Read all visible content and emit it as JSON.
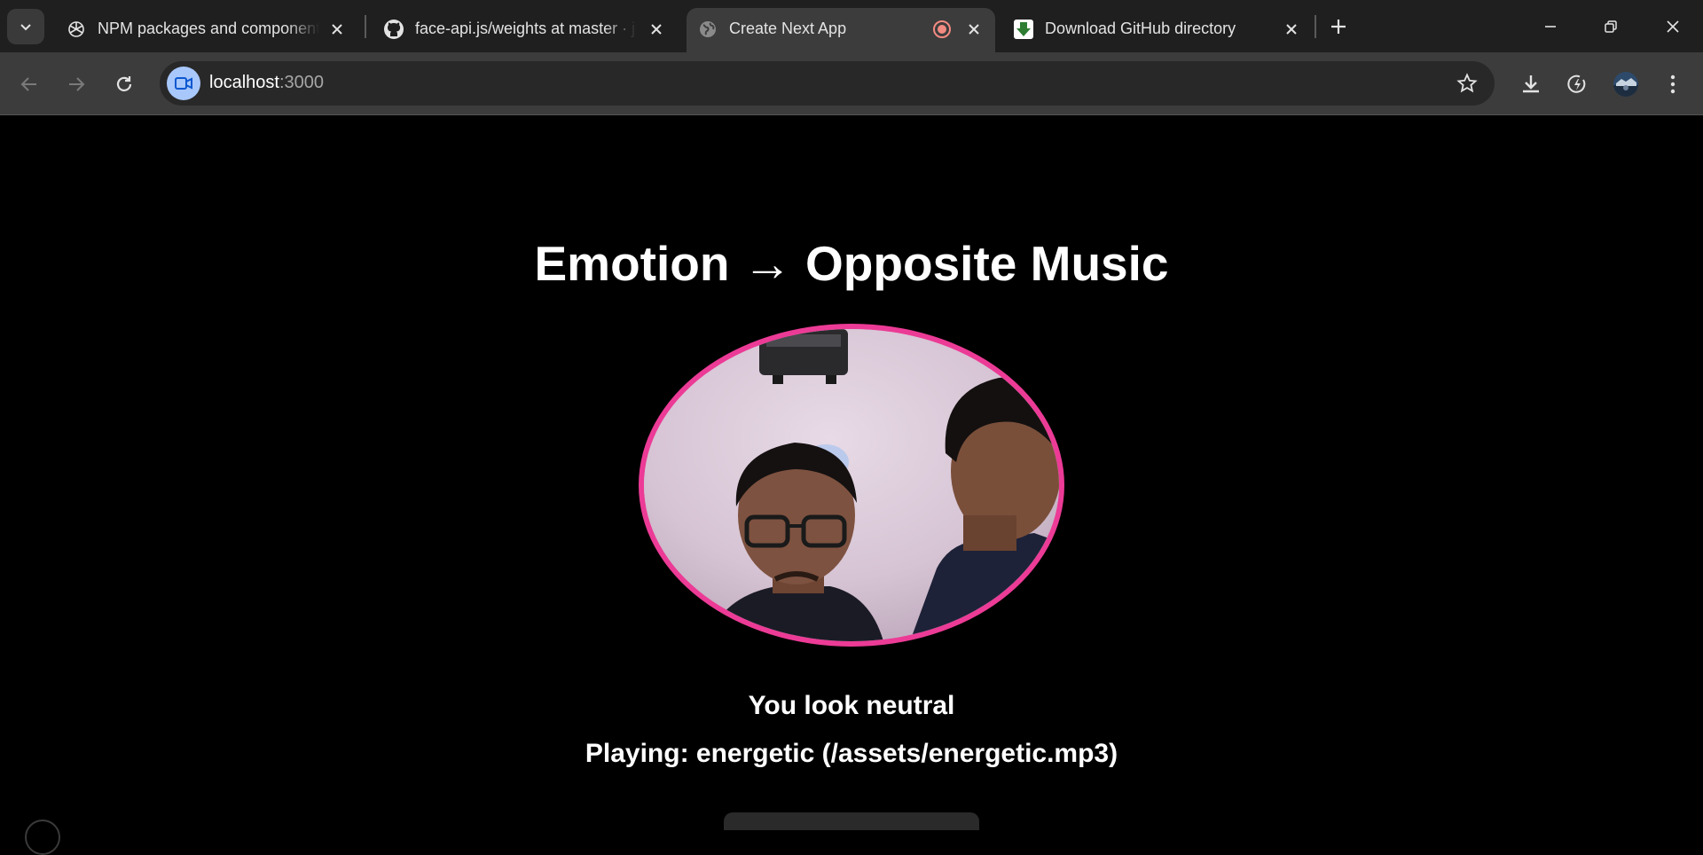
{
  "browser": {
    "tabs": [
      {
        "label": "NPM packages and components",
        "favicon": "openai-icon"
      },
      {
        "label": "face-api.js/weights at master · justadudewhohacks/face-api.js",
        "favicon": "github-icon"
      },
      {
        "label": "Create Next App",
        "favicon": "globe-icon",
        "recording": true
      },
      {
        "label": "Download GitHub directory",
        "favicon": "download-directory-icon"
      }
    ],
    "address": {
      "host": "localhost",
      "port": ":3000"
    }
  },
  "page": {
    "heading": "Emotion → Opposite Music",
    "emotion_text": "You look neutral",
    "playing_text": "Playing: energetic (/assets/energetic.mp3)"
  },
  "colors": {
    "accent": "#ec3b96",
    "background": "#000000",
    "tab_active": "#3c3c3c"
  }
}
